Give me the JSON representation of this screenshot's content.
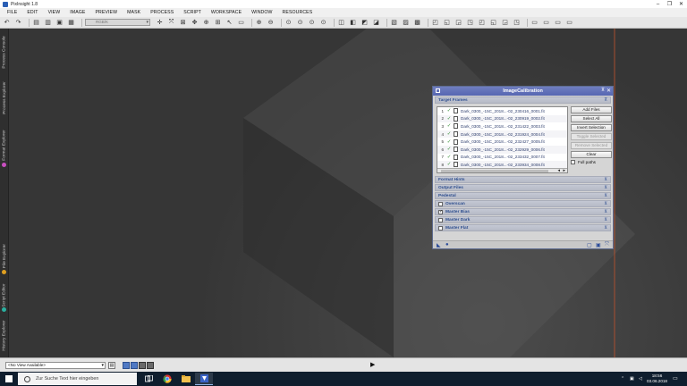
{
  "app": {
    "title": "PixInsight 1.8"
  },
  "window_controls": [
    "–",
    "❐",
    "✕"
  ],
  "menu": [
    "FILE",
    "EDIT",
    "VIEW",
    "IMAGE",
    "PREVIEW",
    "MASK",
    "PROCESS",
    "SCRIPT",
    "WORKSPACE",
    "WINDOW",
    "RESOURCES"
  ],
  "toolbar": {
    "view_select": "RGB/K"
  },
  "side_tabs": [
    "Process Console",
    "Process Explorer",
    "Format Explorer",
    "File Explorer",
    "Script Editor",
    "History Explorer"
  ],
  "dialog": {
    "title": "ImageCalibration",
    "target_frames_label": "Target Frames",
    "files": [
      {
        "n": "1",
        "name": "Dark_0300_-15C_2018...-02_230416_0001.fit"
      },
      {
        "n": "2",
        "name": "Dark_0300_-15C_2018...-02_230919_0002.fit"
      },
      {
        "n": "3",
        "name": "Dark_0300_-15C_2018...-02_231422_0003.fit"
      },
      {
        "n": "4",
        "name": "Dark_0300_-15C_2018...-02_231924_0004.fit"
      },
      {
        "n": "5",
        "name": "Dark_0300_-15C_2018...-02_232427_0005.fit"
      },
      {
        "n": "6",
        "name": "Dark_0300_-15C_2018...-02_232929_0006.fit"
      },
      {
        "n": "7",
        "name": "Dark_0300_-15C_2018...-02_233432_0007.fit"
      },
      {
        "n": "8",
        "name": "Dark_0300_-15C_2018...-02_233934_0008.fit"
      }
    ],
    "buttons": {
      "add_files": "Add Files",
      "select_all": "Select All",
      "invert_selection": "Invert Selection",
      "toggle_selected": "Toggle Selected",
      "remove_selected": "Remove Selected",
      "clear": "Clear"
    },
    "full_paths": "Full paths",
    "sections": {
      "format_hints": "Format Hints",
      "output_files": "Output Files",
      "pedestal": "Pedestal",
      "overscan": "Overscan",
      "master_bias": "Master Bias",
      "master_dark": "Master Dark",
      "master_flat": "Master Flat"
    }
  },
  "viewbar": {
    "view_select": "<No View Available>"
  },
  "taskbar": {
    "search_placeholder": "Zur Suche Text hier eingeben",
    "time": "18:56",
    "date": "03.06.2018"
  },
  "colors": {
    "dialog_title": "#5d6cb6",
    "section_text": "#2f4f8f",
    "workspace": "#3a3a3a",
    "accent_line": "#c4542c"
  }
}
